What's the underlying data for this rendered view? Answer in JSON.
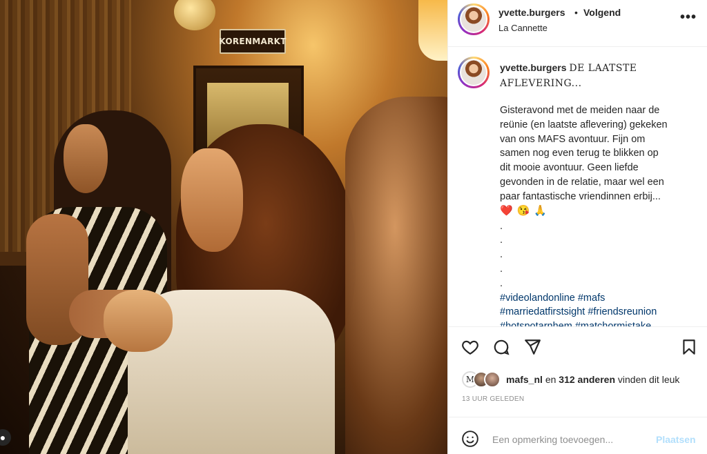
{
  "post": {
    "username": "yvette.burgers",
    "separator": "•",
    "follow_status": "Volgend",
    "location": "La Cannette",
    "more_icon": "more-horizontal-icon",
    "more_label": "•••"
  },
  "photo": {
    "sign_text": "KORENMARKT"
  },
  "caption": {
    "username": "yvette.burgers",
    "title": "DE LAATSTE AFLEVERING...",
    "lines": [
      "Gisteravond met de meiden naar de",
      "reünie (en laatste aflevering) gekeken",
      "van ons MAFS avontuur. Fijn om",
      "samen nog even terug te blikken op",
      "dit mooie avontuur. Geen liefde",
      "gevonden in de relatie, maar wel een",
      "paar fantastische vriendinnen erbij..."
    ],
    "emojis": [
      "❤️",
      "😘",
      "🙏"
    ],
    "dots": [
      ".",
      ".",
      ".",
      ".",
      "."
    ],
    "hashtag_lines": [
      "#videolandonline #mafs",
      "#marriedatfirstsight #friendsreunion",
      "#hotspotarnhem #matchormistake"
    ]
  },
  "actions": {
    "like_icon": "heart-icon",
    "comment_icon": "comment-icon",
    "share_icon": "send-icon",
    "save_icon": "bookmark-icon"
  },
  "likes": {
    "first_liker": "mafs_nl",
    "connector": "en",
    "others": "312 anderen",
    "suffix": "vinden dit leuk",
    "avatar_letter": "M"
  },
  "timestamp": "13 UUR GELEDEN",
  "comment": {
    "emoji_icon": "emoji-icon",
    "placeholder": "Een opmerking toevoegen...",
    "post_label": "Plaatsen"
  },
  "colors": {
    "link": "#00376b",
    "post_disabled": "#b2dffc",
    "muted": "#8e8e8e"
  }
}
